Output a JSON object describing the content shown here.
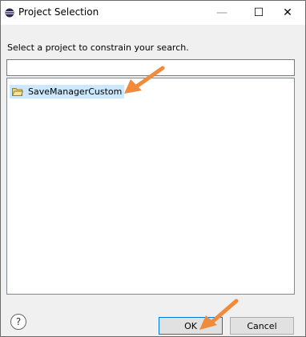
{
  "window": {
    "title": "Project Selection",
    "minimize_glyph": "—",
    "maximize_glyph": "☐",
    "close_glyph": "✕"
  },
  "dialog": {
    "instruction": "Select a project to constrain your search.",
    "filter_value": "",
    "projects": [
      {
        "label": "SaveManagerCustom",
        "selected": true
      }
    ]
  },
  "footer": {
    "help_glyph": "?",
    "ok_label": "OK",
    "cancel_label": "Cancel"
  },
  "colors": {
    "selection": "#cce8ff",
    "annotation_arrow": "#f08a3c",
    "dialog_bg": "#f0f0f0"
  }
}
